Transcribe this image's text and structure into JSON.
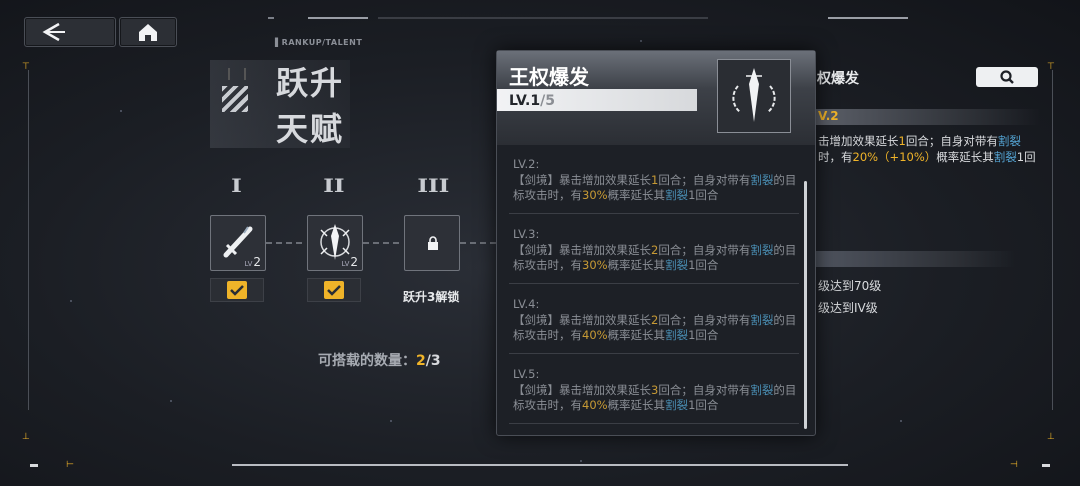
{
  "header": {
    "section_tag": "RANKUP/TALENT",
    "title_line1": "跃升",
    "title_line2": "天赋"
  },
  "talent_tree": {
    "tiers": [
      "I",
      "II",
      "III"
    ],
    "nodes": [
      {
        "name": "sword-talent",
        "level_prefix": "LV",
        "level": "2",
        "checked": true
      },
      {
        "name": "scepter-talent",
        "level_prefix": "LV",
        "level": "2",
        "checked": true
      },
      {
        "name": "locked-talent",
        "locked": true,
        "unlock_label": "跃升3解锁"
      }
    ],
    "equip_count_label": "可搭载的数量：",
    "equip_count_current": "2",
    "equip_count_sep": "/",
    "equip_count_max": "3"
  },
  "popup": {
    "title": "王权爆发",
    "level_label": "LV.1",
    "level_suffix": "/5",
    "entries": [
      {
        "level": "LV.2:",
        "seg1": "【剑境】暴击增加效果延长",
        "dur": "1",
        "seg2": "回合；自身对带有",
        "kw1": "割裂",
        "seg3": "的目标攻击时，有",
        "pct": "30%",
        "seg4": "概率延长其",
        "kw2": "割裂",
        "seg5": "1回合"
      },
      {
        "level": "LV.3:",
        "seg1": "【剑境】暴击增加效果延长",
        "dur": "2",
        "seg2": "回合；自身对带有",
        "kw1": "割裂",
        "seg3": "的目标攻击时，有",
        "pct": "30%",
        "seg4": "概率延长其",
        "kw2": "割裂",
        "seg5": "1回合"
      },
      {
        "level": "LV.4:",
        "seg1": "【剑境】暴击增加效果延长",
        "dur": "2",
        "seg2": "回合；自身对带有",
        "kw1": "割裂",
        "seg3": "的目标攻击时，有",
        "pct": "40%",
        "seg4": "概率延长其",
        "kw2": "割裂",
        "seg5": "1回合"
      },
      {
        "level": "LV.5:",
        "seg1": "【剑境】暴击增加效果延长",
        "dur": "3",
        "seg2": "回合；自身对带有",
        "kw1": "割裂",
        "seg3": "的目标攻击时，有",
        "pct": "40%",
        "seg4": "概率延长其",
        "kw2": "割裂",
        "seg5": "1回合"
      }
    ]
  },
  "right_panel": {
    "title": "权爆发",
    "level": "V.2",
    "desc_a": "击增加效果延长",
    "desc_dur": "1",
    "desc_b": "回合；自身对带有",
    "desc_kw1": "割裂",
    "desc_c": "时，有",
    "desc_pct": "20%（+10%）",
    "desc_d": "概率延长其",
    "desc_kw2": "割裂",
    "desc_e": "1回",
    "requirements": [
      "级达到70级",
      "级达到IV级"
    ]
  },
  "colors": {
    "accent": "#f0b429",
    "keyword": "#55a6d6"
  }
}
